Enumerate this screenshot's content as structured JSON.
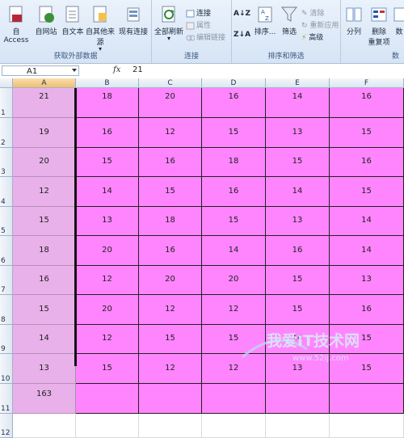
{
  "ribbon": {
    "groups": [
      {
        "label": "获取外部数据"
      },
      {
        "label": "连接"
      },
      {
        "label": "排序和筛选"
      },
      {
        "label": "数"
      }
    ],
    "buttons": {
      "access": "自 Access",
      "web": "自网站",
      "text": "自文本",
      "other": "自其他来源",
      "existing": "现有连接",
      "refresh_all": "全部刷新",
      "connections": "连接",
      "properties": "属性",
      "edit_links": "编辑链接",
      "sort": "排序...",
      "filter": "筛选",
      "clear": "清除",
      "reapply": "重新应用",
      "advanced": "高级",
      "split": "分列",
      "remove_dup_1": "删除",
      "remove_dup_2": "重复项",
      "data_1": "数"
    }
  },
  "formula_bar": {
    "name_box": "A1",
    "fx": "fx",
    "value": "21"
  },
  "columns": [
    "A",
    "B",
    "C",
    "D",
    "E",
    "F"
  ],
  "rows": [
    "1",
    "2",
    "3",
    "4",
    "5",
    "6",
    "7",
    "8",
    "9",
    "10",
    "11",
    "12"
  ],
  "cells": [
    [
      "21",
      "18",
      "20",
      "16",
      "14",
      "16"
    ],
    [
      "19",
      "16",
      "12",
      "15",
      "13",
      "15"
    ],
    [
      "20",
      "15",
      "16",
      "18",
      "15",
      "16"
    ],
    [
      "12",
      "14",
      "15",
      "16",
      "14",
      "15"
    ],
    [
      "15",
      "13",
      "18",
      "15",
      "13",
      "14"
    ],
    [
      "18",
      "20",
      "16",
      "14",
      "16",
      "14"
    ],
    [
      "16",
      "12",
      "20",
      "20",
      "15",
      "13"
    ],
    [
      "15",
      "20",
      "12",
      "12",
      "15",
      "16"
    ],
    [
      "14",
      "12",
      "15",
      "15",
      "14",
      "15"
    ],
    [
      "13",
      "15",
      "12",
      "12",
      "13",
      "15"
    ],
    [
      "163",
      "",
      "",
      "",
      "",
      ""
    ]
  ],
  "watermark": {
    "brand": "我爱IT技术网",
    "url": "www.52ij.com"
  },
  "colors": {
    "col_a_fill": "#e9b1ea",
    "data_fill": "#ff85ff",
    "selected_header": "#f2bf6f"
  }
}
